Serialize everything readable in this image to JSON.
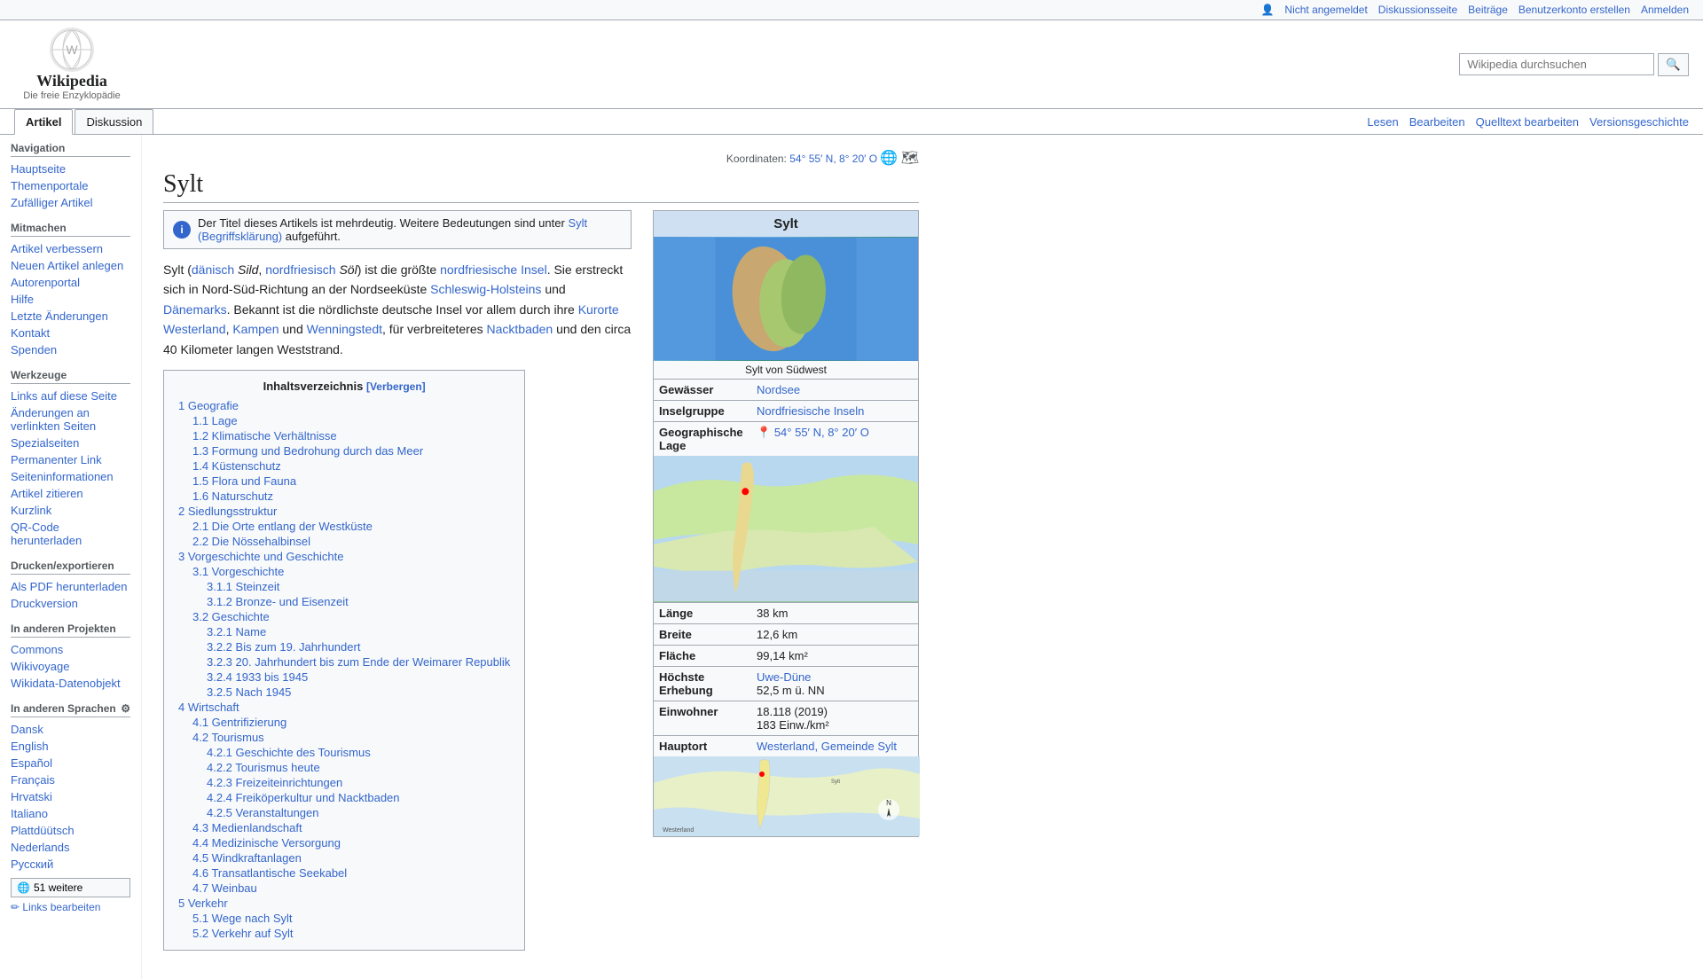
{
  "topbar": {
    "not_logged_in": "Nicht angemeldet",
    "discussion": "Diskussionsseite",
    "contributions": "Beiträge",
    "create_account": "Benutzerkonto erstellen",
    "login": "Anmelden"
  },
  "logo": {
    "title": "Wikipedia",
    "subtitle": "Die freie Enzyklopädie",
    "icon": "🌐"
  },
  "search": {
    "placeholder": "Wikipedia durchsuchen",
    "button_icon": "🔍"
  },
  "tabs": {
    "article": "Artikel",
    "discussion": "Diskussion",
    "read": "Lesen",
    "edit": "Bearbeiten",
    "edit_source": "Quelltext bearbeiten",
    "history": "Versionsgeschichte"
  },
  "coordinates": {
    "label": "Koordinaten:",
    "value": "54° 55′ N, 8° 20′ O"
  },
  "page": {
    "title": "Sylt",
    "disambiguation": "Der Titel dieses Artikels ist mehrdeutig. Weitere Bedeutungen sind unter",
    "disambiguation_link": "Sylt (Begriffsklärung)",
    "disambiguation_suffix": "aufgeführt.",
    "intro": "Sylt (dänisch Sild, nordfriesisch Söl) ist die größte nordfriesische Insel. Sie erstreckt sich in Nord-Süd-Richtung an der Nordseeküste Schleswig-Holsteins und Dänemarks. Bekannt ist die nördlichste deutsche Insel vor allem durch ihre Kurorte Westerland, Kampen und Wenningstedt, für verbreiteteres Nacktbaden und den circa 40 Kilometer langen Weststrand."
  },
  "toc": {
    "title": "Inhaltsverzeichnis",
    "toggle_label": "[Verbergen]",
    "items": [
      {
        "num": "1",
        "label": "Geografie",
        "level": 0
      },
      {
        "num": "1.1",
        "label": "Lage",
        "level": 1
      },
      {
        "num": "1.2",
        "label": "Klimatische Verhältnisse",
        "level": 1
      },
      {
        "num": "1.3",
        "label": "Formung und Bedrohung durch das Meer",
        "level": 1
      },
      {
        "num": "1.4",
        "label": "Küstenschutz",
        "level": 1
      },
      {
        "num": "1.5",
        "label": "Flora und Fauna",
        "level": 1
      },
      {
        "num": "1.6",
        "label": "Naturschutz",
        "level": 1
      },
      {
        "num": "2",
        "label": "Siedlungsstruktur",
        "level": 0
      },
      {
        "num": "2.1",
        "label": "Die Orte entlang der Westküste",
        "level": 1
      },
      {
        "num": "2.2",
        "label": "Die Nössehalbinsel",
        "level": 1
      },
      {
        "num": "3",
        "label": "Vorgeschichte und Geschichte",
        "level": 0
      },
      {
        "num": "3.1",
        "label": "Vorgeschichte",
        "level": 1
      },
      {
        "num": "3.1.1",
        "label": "Steinzeit",
        "level": 2
      },
      {
        "num": "3.1.2",
        "label": "Bronze- und Eisenzeit",
        "level": 2
      },
      {
        "num": "3.2",
        "label": "Geschichte",
        "level": 1
      },
      {
        "num": "3.2.1",
        "label": "Name",
        "level": 2
      },
      {
        "num": "3.2.2",
        "label": "Bis zum 19. Jahrhundert",
        "level": 2
      },
      {
        "num": "3.2.3",
        "label": "20. Jahrhundert bis zum Ende der Weimarer Republik",
        "level": 2
      },
      {
        "num": "3.2.4",
        "label": "1933 bis 1945",
        "level": 2
      },
      {
        "num": "3.2.5",
        "label": "Nach 1945",
        "level": 2
      },
      {
        "num": "4",
        "label": "Wirtschaft",
        "level": 0
      },
      {
        "num": "4.1",
        "label": "Gentrifizierung",
        "level": 1
      },
      {
        "num": "4.2",
        "label": "Tourismus",
        "level": 1
      },
      {
        "num": "4.2.1",
        "label": "Geschichte des Tourismus",
        "level": 2
      },
      {
        "num": "4.2.2",
        "label": "Tourismus heute",
        "level": 2
      },
      {
        "num": "4.2.3",
        "label": "Freizeiteinrichtungen",
        "level": 2
      },
      {
        "num": "4.2.4",
        "label": "Freiköperkultur und Nacktbaden",
        "level": 2
      },
      {
        "num": "4.2.5",
        "label": "Veranstaltungen",
        "level": 2
      },
      {
        "num": "4.3",
        "label": "Medienlandschaft",
        "level": 1
      },
      {
        "num": "4.4",
        "label": "Medizinische Versorgung",
        "level": 1
      },
      {
        "num": "4.5",
        "label": "Windkraftanlagen",
        "level": 1
      },
      {
        "num": "4.6",
        "label": "Transatlantische Seekabel",
        "level": 1
      },
      {
        "num": "4.7",
        "label": "Weinbau",
        "level": 1
      },
      {
        "num": "5",
        "label": "Verkehr",
        "level": 0
      },
      {
        "num": "5.1",
        "label": "Wege nach Sylt",
        "level": 1
      },
      {
        "num": "5.2",
        "label": "Verkehr auf Sylt",
        "level": 1
      }
    ]
  },
  "infobox": {
    "title": "Sylt",
    "image_caption": "Sylt von Südwest",
    "rows": [
      {
        "label": "Gewässer",
        "value": "Nordsee",
        "link": true
      },
      {
        "label": "Inselgruppe",
        "value": "Nordfriesische Inseln",
        "link": true
      },
      {
        "label": "Geographische Lage",
        "value": "54° 55′ N, 8° 20′ O",
        "icon": true
      },
      {
        "label": "Länge",
        "value": "38 km"
      },
      {
        "label": "Breite",
        "value": "12,6 km"
      },
      {
        "label": "Fläche",
        "value": "99,14 km²"
      },
      {
        "label": "Höchste Erhebung",
        "value": "Uwe-Düne",
        "sub": "52,5 m ü. NN",
        "link": true
      },
      {
        "label": "Einwohner",
        "value": "18.118 (2019)",
        "sub": "183 Einw./km²"
      },
      {
        "label": "Hauptort",
        "value": "Westerland, Gemeinde Sylt",
        "link": true
      }
    ]
  },
  "sidebar": {
    "navigation": {
      "title": "Navigation",
      "items": [
        {
          "label": "Hauptseite"
        },
        {
          "label": "Themenportale"
        },
        {
          "label": "Zufälliger Artikel"
        }
      ]
    },
    "participate": {
      "title": "Mitmachen",
      "items": [
        {
          "label": "Artikel verbessern"
        },
        {
          "label": "Neuen Artikel anlegen"
        },
        {
          "label": "Autorenportal"
        },
        {
          "label": "Hilfe"
        },
        {
          "label": "Letzte Änderungen"
        },
        {
          "label": "Kontakt"
        },
        {
          "label": "Spenden"
        }
      ]
    },
    "tools": {
      "title": "Werkzeuge",
      "items": [
        {
          "label": "Links auf diese Seite"
        },
        {
          "label": "Änderungen an verlinkten Seiten"
        },
        {
          "label": "Spezialseiten"
        },
        {
          "label": "Permanenter Link"
        },
        {
          "label": "Seiteninformationen"
        },
        {
          "label": "Artikel zitieren"
        },
        {
          "label": "Kurzlink"
        },
        {
          "label": "QR-Code herunterladen"
        }
      ]
    },
    "print": {
      "title": "Drucken/exportieren",
      "items": [
        {
          "label": "Als PDF herunterladen"
        },
        {
          "label": "Druckversion"
        }
      ]
    },
    "other_projects": {
      "title": "In anderen Projekten",
      "items": [
        {
          "label": "Commons"
        },
        {
          "label": "Wikivoyage"
        },
        {
          "label": "Wikidata-Datenobjekt"
        }
      ]
    },
    "other_languages": {
      "title": "In anderen Sprachen",
      "gear_icon": "⚙",
      "items": [
        {
          "label": "Dansk"
        },
        {
          "label": "English"
        },
        {
          "label": "Español"
        },
        {
          "label": "Français"
        },
        {
          "label": "Hrvatski"
        },
        {
          "label": "Italiano"
        },
        {
          "label": "Plattdüütsch"
        },
        {
          "label": "Nederlands"
        },
        {
          "label": "Русский"
        }
      ],
      "more_button": "51 weitere",
      "edit_links": "Links bearbeiten"
    }
  }
}
